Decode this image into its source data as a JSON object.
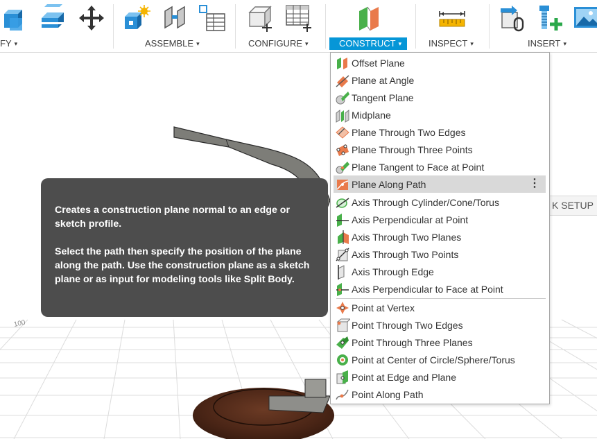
{
  "toolbar": {
    "groups": [
      {
        "label": "FY",
        "caret": "▾"
      },
      {
        "label": "ASSEMBLE",
        "caret": "▾"
      },
      {
        "label": "CONFIGURE",
        "caret": "▾"
      },
      {
        "label": "CONSTRUCT",
        "caret": "▾"
      },
      {
        "label": "INSPECT",
        "caret": "▾"
      },
      {
        "label": "INSERT",
        "caret": "▾"
      }
    ],
    "active_group": "CONSTRUCT",
    "accent_color": "#0696d7"
  },
  "viewport": {
    "setup_tab_label": "K SETUP",
    "axis_label": "100"
  },
  "tooltip": {
    "paragraph_1": "Creates a construction plane normal to an edge or sketch profile.",
    "paragraph_2": "Select the path then specify the position of the plane along the path. Use the construction plane as a sketch plane or as input for modeling tools like Split Body."
  },
  "construct_menu": {
    "planes": [
      {
        "label": "Offset Plane",
        "icon": "offset-plane-icon"
      },
      {
        "label": "Plane at Angle",
        "icon": "plane-at-angle-icon"
      },
      {
        "label": "Tangent Plane",
        "icon": "tangent-plane-icon"
      },
      {
        "label": "Midplane",
        "icon": "midplane-icon"
      },
      {
        "label": "Plane Through Two Edges",
        "icon": "plane-two-edges-icon"
      },
      {
        "label": "Plane Through Three Points",
        "icon": "plane-three-points-icon"
      },
      {
        "label": "Plane Tangent to Face at Point",
        "icon": "plane-tangent-face-icon"
      },
      {
        "label": "Plane Along Path",
        "icon": "plane-along-path-icon",
        "highlighted": true,
        "more": "⋮"
      }
    ],
    "axes": [
      {
        "label": "Axis Through Cylinder/Cone/Torus",
        "icon": "axis-cylinder-icon"
      },
      {
        "label": "Axis Perpendicular at Point",
        "icon": "axis-perpendicular-point-icon"
      },
      {
        "label": "Axis Through Two Planes",
        "icon": "axis-two-planes-icon"
      },
      {
        "label": "Axis Through Two Points",
        "icon": "axis-two-points-icon"
      },
      {
        "label": "Axis Through Edge",
        "icon": "axis-edge-icon"
      },
      {
        "label": "Axis Perpendicular to Face at Point",
        "icon": "axis-perpendicular-face-icon"
      }
    ],
    "points": [
      {
        "label": "Point at Vertex",
        "icon": "point-vertex-icon"
      },
      {
        "label": "Point Through Two Edges",
        "icon": "point-two-edges-icon"
      },
      {
        "label": "Point Through Three Planes",
        "icon": "point-three-planes-icon"
      },
      {
        "label": "Point at Center of Circle/Sphere/Torus",
        "icon": "point-center-icon"
      },
      {
        "label": "Point at Edge and Plane",
        "icon": "point-edge-plane-icon"
      },
      {
        "label": "Point Along Path",
        "icon": "point-along-path-icon"
      }
    ]
  }
}
